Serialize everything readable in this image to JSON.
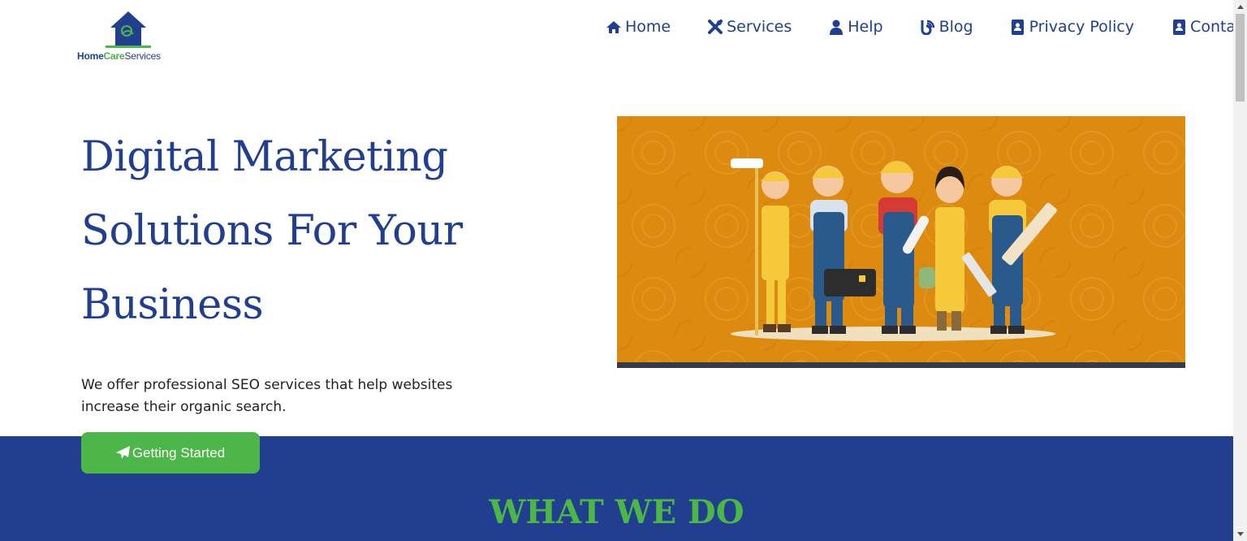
{
  "logo": {
    "part_home": "Home",
    "part_care": "Care",
    "part_services": "Services"
  },
  "nav": {
    "items": [
      {
        "label": "Home",
        "icon": "home-icon"
      },
      {
        "label": "Services",
        "icon": "tools-icon"
      },
      {
        "label": "Help",
        "icon": "user-icon"
      },
      {
        "label": "Blog",
        "icon": "blog-icon"
      },
      {
        "label": "Privacy Policy",
        "icon": "contact-card-icon"
      },
      {
        "label": "Contact",
        "icon": "address-book-icon"
      }
    ]
  },
  "hero": {
    "title": "Digital Marketing Solutions For Your Business",
    "subtitle": "We offer professional SEO services that help websites increase their organic search.",
    "cta_label": "Getting Started",
    "cta_icon": "paper-plane-icon",
    "image": "workers-team-illustration"
  },
  "section": {
    "title": "WHAT WE DO"
  },
  "colors": {
    "brand_blue": "#223f8f",
    "brand_green": "#4cb648",
    "hero_image_bg": "#dc8a10"
  }
}
